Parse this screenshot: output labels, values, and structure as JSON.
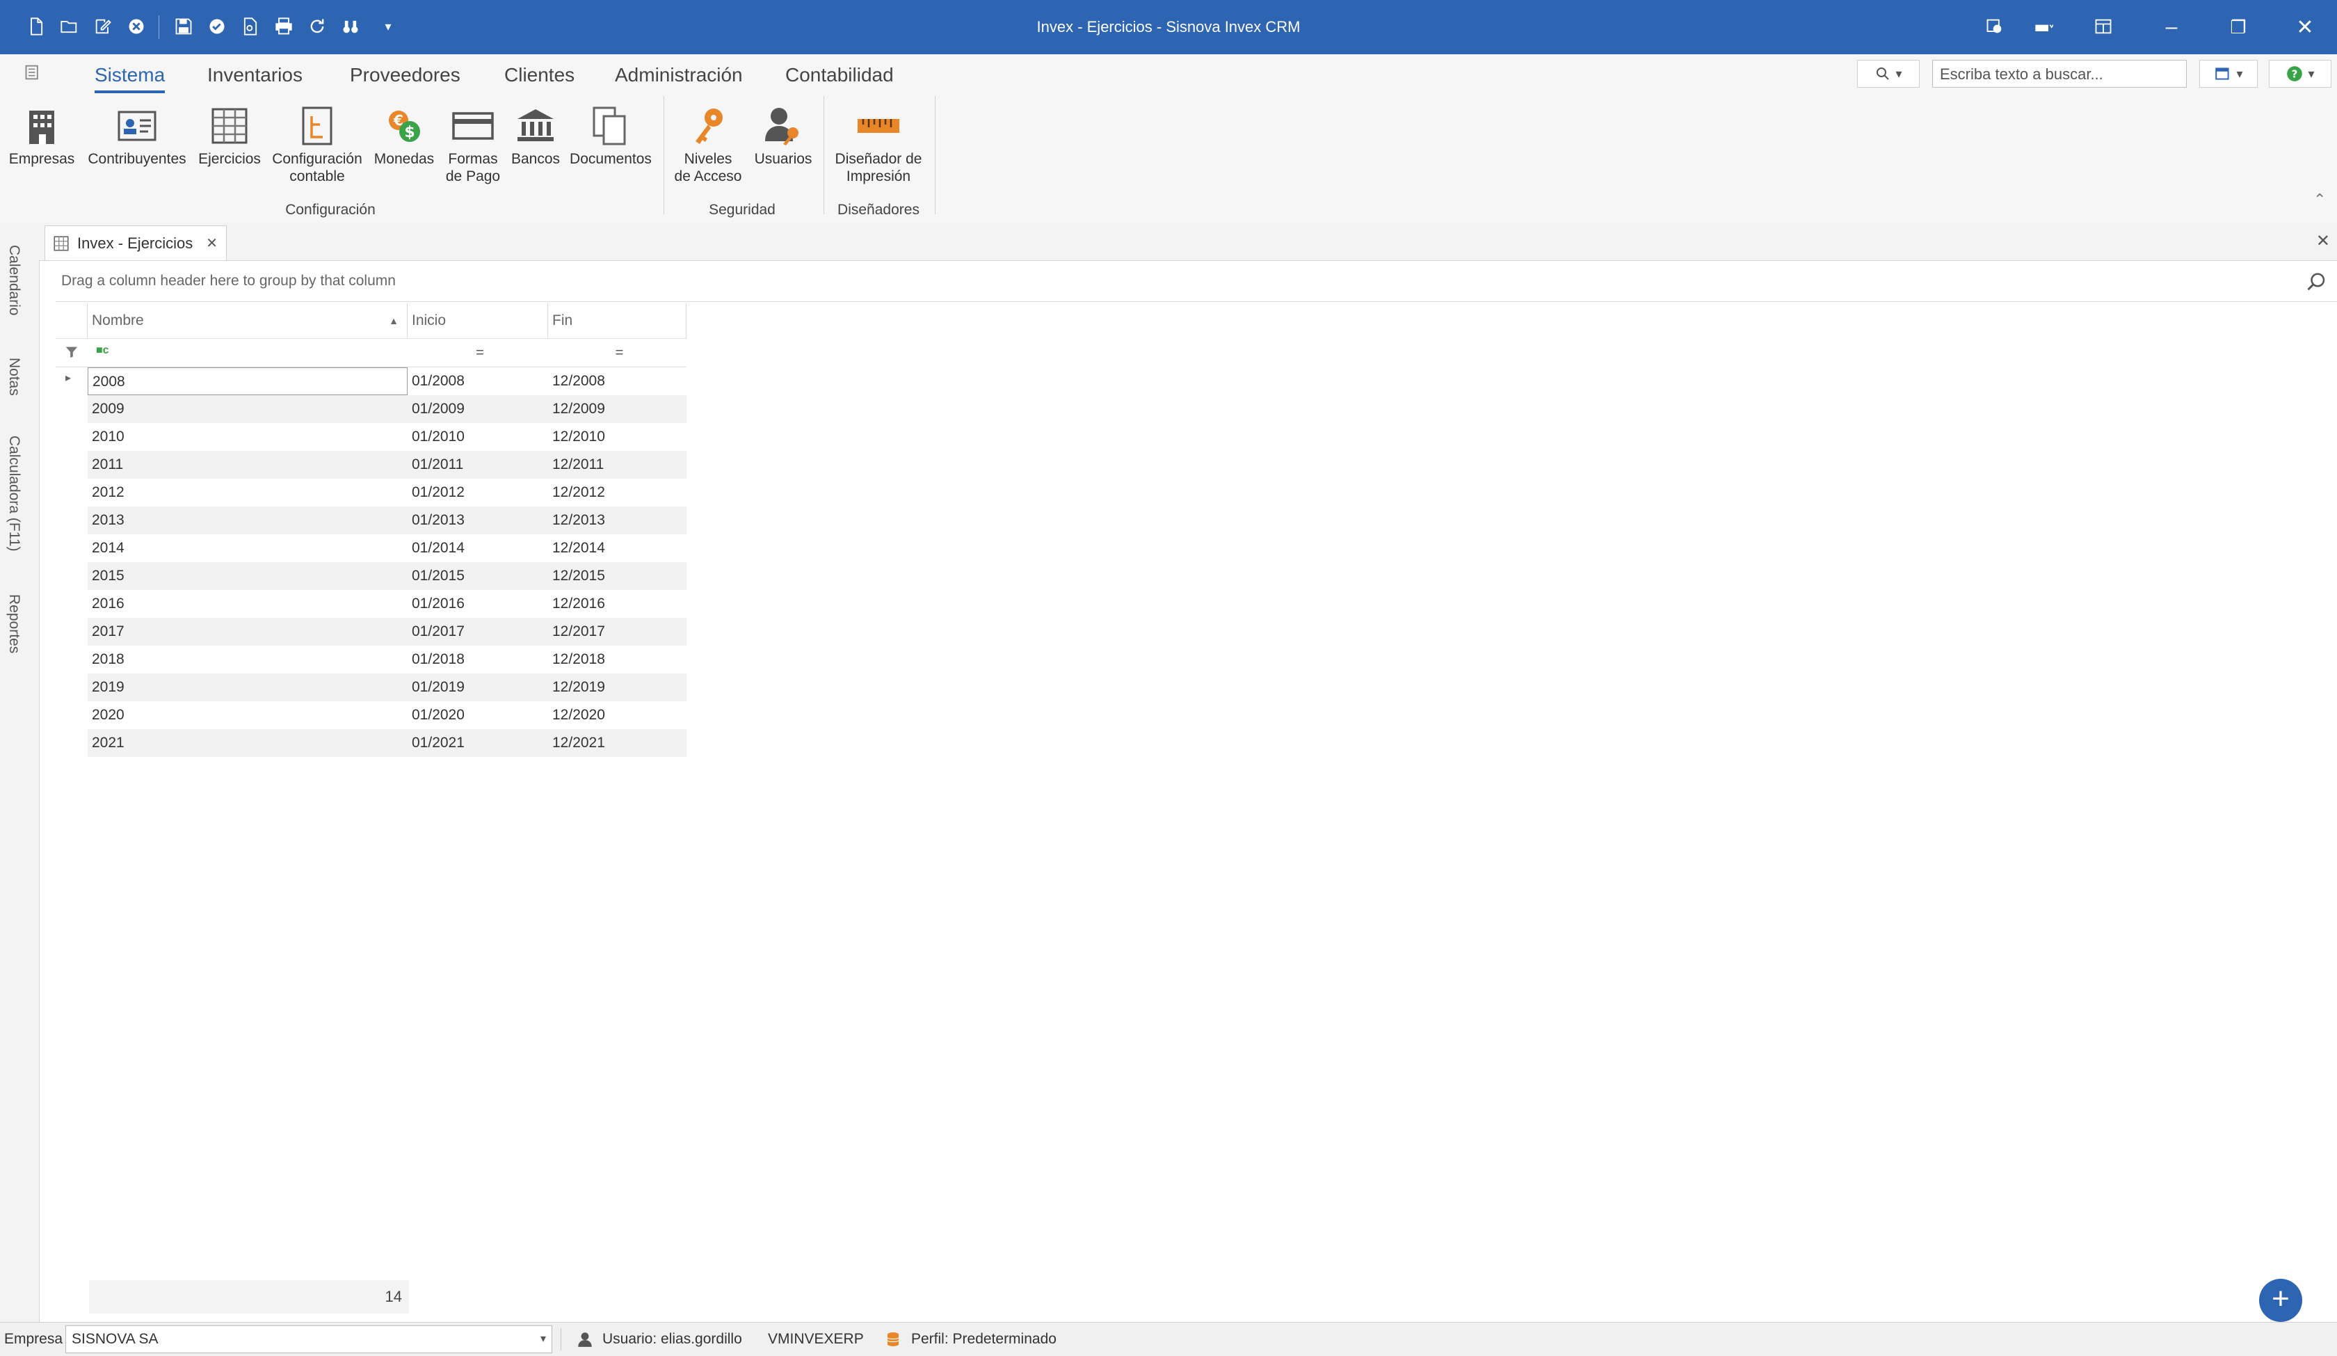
{
  "window": {
    "title": "Invex - Ejercicios - Sisnova Invex CRM",
    "accent": "#2d65b2"
  },
  "quick_access": [
    "new-file-icon",
    "open-folder-icon",
    "edit-icon",
    "cancel-icon",
    "save-icon",
    "check-icon",
    "preview-icon",
    "print-icon",
    "refresh-icon",
    "binoculars-icon",
    "dropdown-icon"
  ],
  "ribbon": {
    "tabs": [
      "Sistema",
      "Inventarios",
      "Proveedores",
      "Clientes",
      "Administración",
      "Contabilidad"
    ],
    "active_tab": "Sistema",
    "search_placeholder": "Escriba texto a buscar...",
    "groups": {
      "configuracion": {
        "label": "Configuración",
        "buttons": [
          {
            "label": "Empresas",
            "icon": "building-icon"
          },
          {
            "label": "Contribuyentes",
            "icon": "contact-card-icon"
          },
          {
            "label": "Ejercicios",
            "icon": "grid-icon"
          },
          {
            "label_1": "Configuración",
            "label_2": "contable",
            "icon": "accounting-icon"
          },
          {
            "label": "Monedas",
            "icon": "coins-icon"
          },
          {
            "label_1": "Formas",
            "label_2": "de Pago",
            "icon": "credit-card-icon"
          },
          {
            "label": "Bancos",
            "icon": "bank-icon"
          },
          {
            "label": "Documentos",
            "icon": "documents-icon"
          }
        ]
      },
      "seguridad": {
        "label": "Seguridad",
        "buttons": [
          {
            "label_1": "Niveles",
            "label_2": "de Acceso",
            "icon": "key-icon"
          },
          {
            "label": "Usuarios",
            "icon": "user-key-icon"
          }
        ]
      },
      "disenadores": {
        "label": "Diseñadores",
        "buttons": [
          {
            "label_1": "Diseñador de",
            "label_2": "Impresión",
            "icon": "ruler-icon"
          }
        ]
      }
    }
  },
  "side_tabs": [
    "Calendario",
    "Notas",
    "Calculadora (F11)",
    "Reportes"
  ],
  "document_tab": {
    "label": "Invex - Ejercicios"
  },
  "grid": {
    "group_panel_text": "Drag a column header here to group by that column",
    "columns": [
      "Nombre",
      "Inicio",
      "Fin"
    ],
    "rows": [
      [
        "2008",
        "01/2008",
        "12/2008"
      ],
      [
        "2009",
        "01/2009",
        "12/2009"
      ],
      [
        "2010",
        "01/2010",
        "12/2010"
      ],
      [
        "2011",
        "01/2011",
        "12/2011"
      ],
      [
        "2012",
        "01/2012",
        "12/2012"
      ],
      [
        "2013",
        "01/2013",
        "12/2013"
      ],
      [
        "2014",
        "01/2014",
        "12/2014"
      ],
      [
        "2015",
        "01/2015",
        "12/2015"
      ],
      [
        "2016",
        "01/2016",
        "12/2016"
      ],
      [
        "2017",
        "01/2017",
        "12/2017"
      ],
      [
        "2018",
        "01/2018",
        "12/2018"
      ],
      [
        "2019",
        "01/2019",
        "12/2019"
      ],
      [
        "2020",
        "01/2020",
        "12/2020"
      ],
      [
        "2021",
        "01/2021",
        "12/2021"
      ]
    ],
    "footer_count": "14"
  },
  "status": {
    "empresa_label": "Empresa",
    "empresa_value": "SISNOVA SA",
    "usuario": "Usuario: elias.gordillo",
    "machine": "VMINVEXERP",
    "perfil": "Perfil: Predeterminado"
  }
}
